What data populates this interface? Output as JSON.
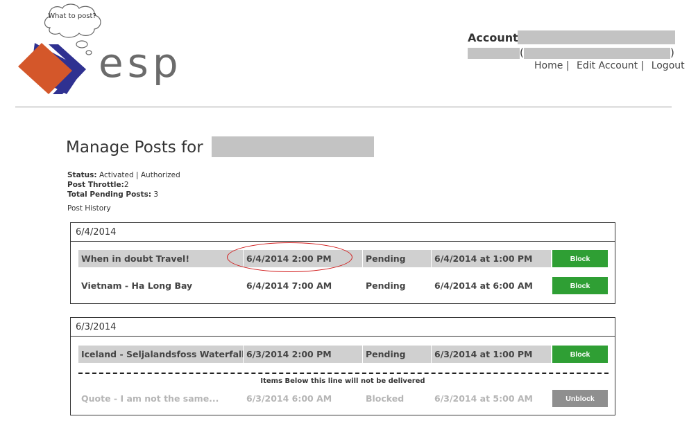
{
  "logo": {
    "bubble_text": "What to post?",
    "brand": "esp"
  },
  "account": {
    "label": "Account:",
    "open_paren": "(",
    "close_paren": ")"
  },
  "nav": {
    "home": "Home",
    "edit_account": "Edit Account",
    "logout": "Logout",
    "separator": "|"
  },
  "page": {
    "title": "Manage Posts for",
    "status_label": "Status:",
    "status_value": "Activated | Authorized",
    "throttle_label": "Post Throttle:",
    "throttle_value": "2",
    "pending_label": "Total Pending Posts:",
    "pending_value": "3",
    "history_label": "Post History"
  },
  "groups": [
    {
      "date": "6/4/2014",
      "rows": [
        {
          "title": "When in doubt Travel!",
          "scheduled": "6/4/2014 2:00 PM",
          "status": "Pending",
          "created": "6/4/2014 at 1:00 PM",
          "action": "Block"
        },
        {
          "title": "Vietnam - Ha Long Bay",
          "scheduled": "6/4/2014 7:00 AM",
          "status": "Pending",
          "created": "6/4/2014 at 6:00 AM",
          "action": "Block"
        }
      ]
    },
    {
      "date": "6/3/2014",
      "rows": [
        {
          "title": "Iceland - Seljalandsfoss Waterfall",
          "scheduled": "6/3/2014 2:00 PM",
          "status": "Pending",
          "created": "6/3/2014 at 1:00 PM",
          "action": "Block"
        },
        {
          "title": "Quote - I am not the same...",
          "scheduled": "6/3/2014 6:00 AM",
          "status": "Blocked",
          "created": "6/3/2014 at 5:00 AM",
          "action": "Unblock"
        }
      ],
      "divider_note": "Items Below this line will not be delivered"
    }
  ],
  "colors": {
    "block_button": "#2f9f34",
    "unblock_button": "#8f8f8f",
    "highlight": "#d11a1a",
    "logo_orange": "#d4572a",
    "logo_navy": "#2f3191"
  }
}
